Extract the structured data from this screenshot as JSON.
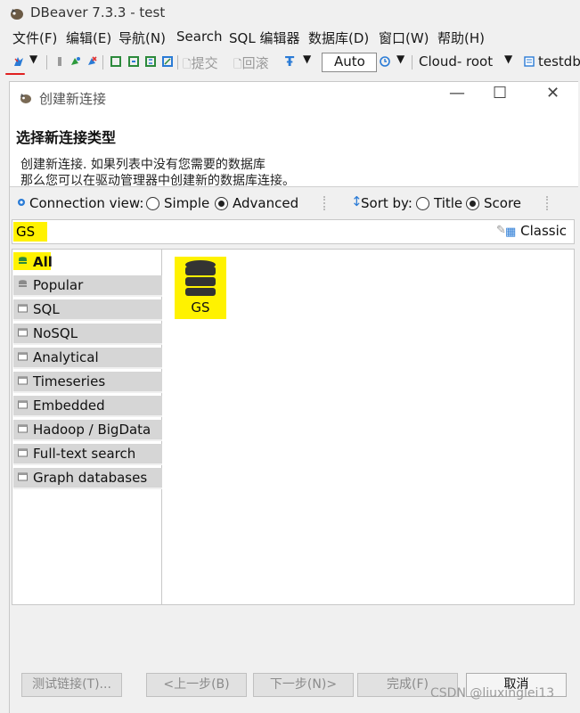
{
  "window": {
    "title": "DBeaver 7.3.3 - test"
  },
  "menu": {
    "items": [
      "文件(F)",
      "编辑(E)",
      "导航(N)",
      "Search",
      "SQL 编辑器",
      "数据库(D)",
      "窗口(W)",
      "帮助(H)"
    ]
  },
  "toolbar": {
    "commit_label": "提交",
    "rollback_label": "回滚",
    "mode_value": "Auto",
    "datasource": "Cloud- root",
    "database": "testdb"
  },
  "dialog": {
    "title": "创建新连接",
    "heading": "选择新连接类型",
    "description_line1": "创建新连接. 如果列表中没有您需要的数据库",
    "description_line2": "那么您可以在驱动管理器中创建新的数据库连接。",
    "connection_view_label": "Connection view:",
    "view_simple": "Simple",
    "view_advanced": "Advanced",
    "view_selected": "Advanced",
    "sort_by_label": "Sort by:",
    "sort_title": "Title",
    "sort_score": "Score",
    "sort_selected": "Score",
    "search_value": "GS",
    "classic_label": "Classic"
  },
  "categories": [
    {
      "label": "All",
      "selected": true
    },
    {
      "label": "Popular"
    },
    {
      "label": "SQL"
    },
    {
      "label": "NoSQL"
    },
    {
      "label": "Analytical"
    },
    {
      "label": "Timeseries"
    },
    {
      "label": "Embedded"
    },
    {
      "label": "Hadoop / BigData"
    },
    {
      "label": "Full-text search"
    },
    {
      "label": "Graph databases"
    }
  ],
  "databases": [
    {
      "label": "GS",
      "icon": "database-icon"
    }
  ],
  "buttons": {
    "test": "测试链接(T)...",
    "back": "<上一步(B)",
    "next": "下一步(N)>",
    "finish": "完成(F)",
    "cancel": "取消"
  },
  "watermark": "CSDN @liuxinglei13",
  "colors": {
    "highlight": "#fff200",
    "category_bg": "#d6d6d6",
    "annotation_red": "#e02020"
  }
}
